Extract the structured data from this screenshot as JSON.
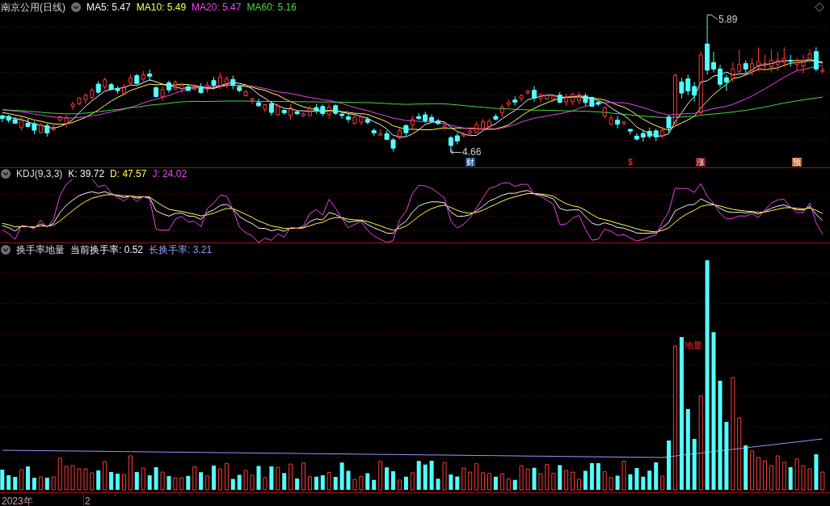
{
  "price_panel": {
    "title": "南京公用(日线)",
    "indicators": [
      {
        "label": "MA5: 5.47",
        "color": "#f4f4f4"
      },
      {
        "label": "MA10: 5.49",
        "color": "#ffff55"
      },
      {
        "label": "MA20: 5.47",
        "color": "#ee44ee"
      },
      {
        "label": "MA60: 5.16",
        "color": "#44dd44"
      }
    ],
    "high_label": "5.89",
    "low_label": "4.66",
    "events": [
      {
        "label": "财",
        "kind": "tag",
        "color": "#1d4f91"
      },
      {
        "label": "$",
        "kind": "glyph",
        "color": "#ee2222"
      },
      {
        "label": "涨",
        "kind": "tag",
        "color": "#8a0e0e"
      },
      {
        "label": "预",
        "kind": "tag",
        "color": "#c4622b"
      }
    ]
  },
  "kdj_panel": {
    "title": "KDJ(9,3,3)",
    "values": [
      {
        "label": "K: 39.72",
        "color": "#f4f4f4"
      },
      {
        "label": "D: 47.57",
        "color": "#ffff55"
      },
      {
        "label": "J: 24.02",
        "color": "#ee44ee"
      }
    ]
  },
  "turnover_panel": {
    "title": "换手率地量",
    "readings": [
      {
        "label": "当前换手率: 0.52",
        "color": "#f4f4f4"
      },
      {
        "label": "长换手率: 3.21",
        "color": "#9a9aff"
      }
    ],
    "marker": "地量"
  },
  "time_axis": {
    "labels": [
      "2023年",
      "2"
    ]
  }
}
